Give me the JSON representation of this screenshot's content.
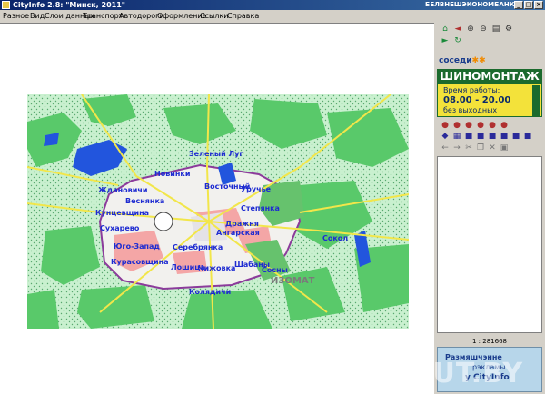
{
  "window": {
    "title": "CityInfo 2.8: \"Минск, 2011\"",
    "bank": "БЕЛВНЕШЭКОНОМБАНК",
    "btn_min": "_",
    "btn_max": "□",
    "btn_close": "×"
  },
  "menu": [
    "Разное",
    "Вид",
    "Слои данных",
    "Транспорт",
    "Автодороги",
    "Оформление",
    "Ссылки",
    "Справка"
  ],
  "map": {
    "districts": [
      "Зеленый Луг",
      "Новинки",
      "Восточный",
      "Ждановичи",
      "Веснянка",
      "Кунцевщина",
      "Сухарево",
      "Юго-Запад",
      "Курасовщина",
      "Лошица",
      "Чижовка",
      "Серебрянка",
      "Шабаны",
      "Ангарская",
      "Степянка",
      "Дражня",
      "Уручье",
      "Сосны",
      "Колядичи",
      "Сокол"
    ],
    "ads": [
      "ИЗОМАТ"
    ]
  },
  "sidebar": {
    "logo": "соседи",
    "banner_title": "ШИНОМОНТАЖ",
    "hours_label": "Время работы:",
    "hours": "08.00 - 20.00",
    "days": "без выходных",
    "scale": "1 : 281668",
    "ad_line1": "Размяшчэнне",
    "ad_line2": "рэкламы",
    "ad_line3": "у CityInfo"
  },
  "watermark": "TUT.BY"
}
